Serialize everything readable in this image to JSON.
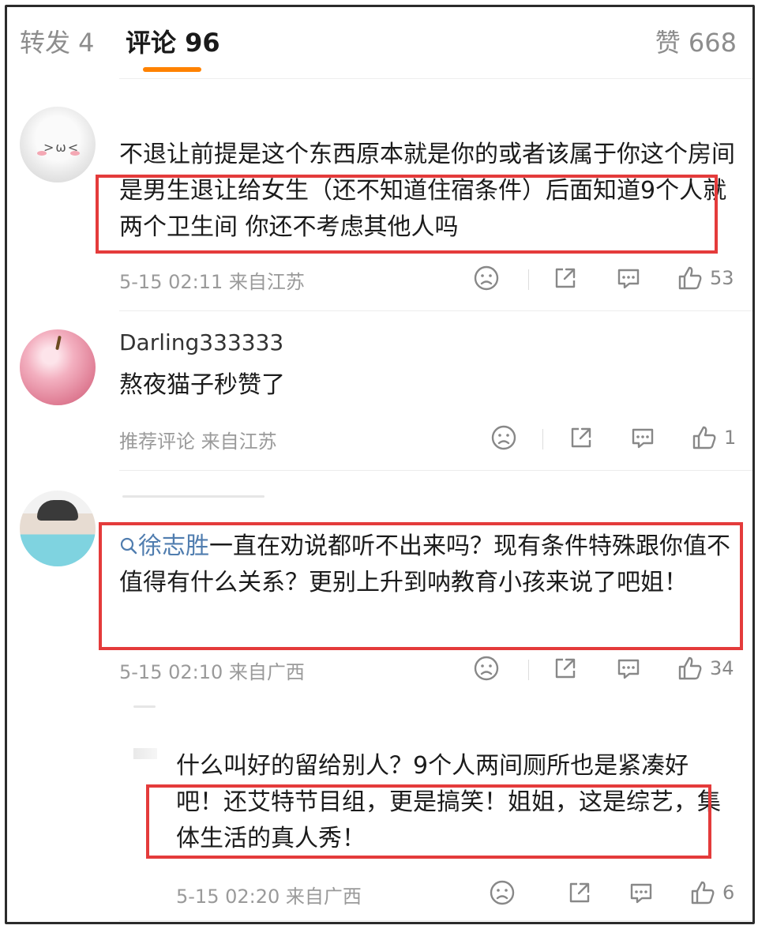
{
  "tabs": {
    "repost": "转发 4",
    "comments": "评论 96",
    "likes": "赞 668"
  },
  "comments": [
    {
      "text": "不退让前提是这个东西原本就是你的或者该属于你这个房间是男生退让给女生（还不知道住宿条件）后面知道9个人就两个卫生间 你还不考虑其他人吗",
      "meta": "5-15 02:11 来自江苏",
      "likes": "53"
    },
    {
      "username": "Darling333333",
      "text": "熬夜猫子秒赞了",
      "meta": "推荐评论 来自江苏",
      "likes": "1"
    },
    {
      "mention": "徐志胜",
      "text": "一直在劝说都听不出来吗？现有条件特殊跟你值不值得有什么关系？更别上升到呐教育小孩来说了吧姐！",
      "meta": "5-15 02:10 来自广西",
      "likes": "34"
    },
    {
      "text": "什么叫好的留给别人？9个人两间厕所也是紧凑好吧！还艾特节目组，更是搞笑！姐姐，这是综艺，集体生活的真人秀！",
      "meta": "5-15 02:20 来自广西",
      "likes": "6"
    }
  ],
  "icons": {
    "dislike": "sad-face-icon",
    "share": "share-icon",
    "reply": "comment-bubble-icon",
    "like": "thumbs-up-icon"
  },
  "colors": {
    "accent": "#ff8200",
    "highlight_box": "#e43b3b",
    "mention": "#507daf"
  }
}
